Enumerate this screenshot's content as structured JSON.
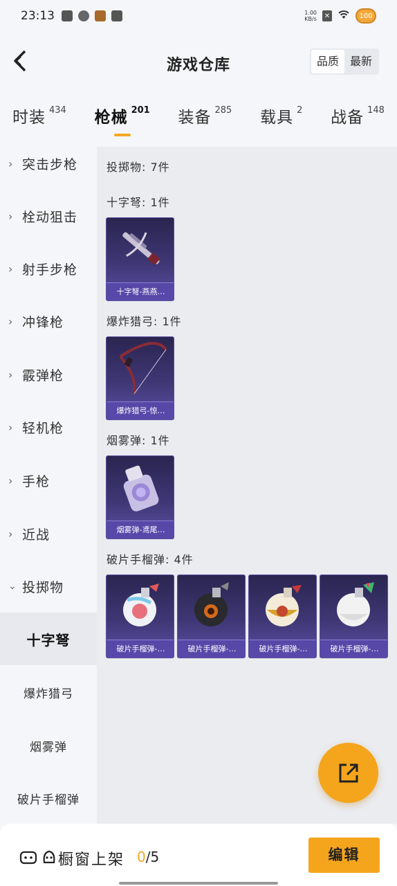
{
  "status_bar": {
    "time": "23:13",
    "net_speed_value": "1.00",
    "net_speed_unit": "KB/s",
    "battery": "100"
  },
  "header": {
    "title": "游戏仓库",
    "sort_options": [
      "品质",
      "最新"
    ]
  },
  "tabs": [
    {
      "label": "时装",
      "count": "434"
    },
    {
      "label": "枪械",
      "count": "201"
    },
    {
      "label": "装备",
      "count": "285"
    },
    {
      "label": "载具",
      "count": "2"
    },
    {
      "label": "战备",
      "count": "148"
    }
  ],
  "sidebar": {
    "categories": [
      "突击步枪",
      "栓动狙击",
      "射手步枪",
      "冲锋枪",
      "霰弹枪",
      "轻机枪",
      "手枪",
      "近战",
      "投掷物"
    ],
    "subcategories": [
      "十字弩",
      "爆炸猎弓",
      "烟雾弹",
      "破片手榴弹"
    ]
  },
  "content": {
    "summary": "投掷物: 7件",
    "sections": [
      {
        "title": "十字弩: 1件",
        "items": [
          "十字弩-燕燕…"
        ]
      },
      {
        "title": "爆炸猎弓: 1件",
        "items": [
          "爆炸猎弓-惊…"
        ]
      },
      {
        "title": "烟雾弹: 1件",
        "items": [
          "烟雾弹-鸢尾…"
        ]
      },
      {
        "title": "破片手榴弹: 4件",
        "items": [
          "破片手榴弹-…",
          "破片手榴弹-…",
          "破片手榴弹-…",
          "破片手榴弹-…"
        ]
      }
    ]
  },
  "bottom_bar": {
    "label": "橱窗上架",
    "count_current": "0",
    "count_total": "/5",
    "edit_label": "编辑"
  },
  "colors": {
    "accent": "#f5a51c",
    "card_top": "#2a2550",
    "card_bottom": "#5d4fa6"
  }
}
